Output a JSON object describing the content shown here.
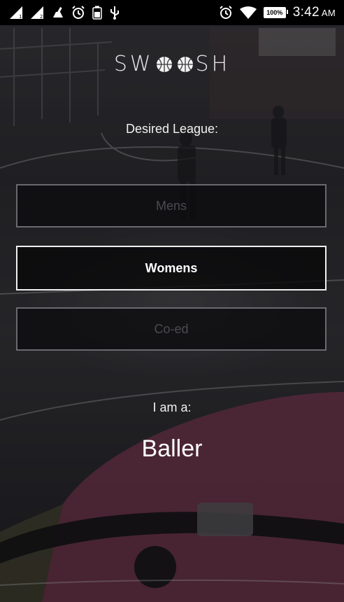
{
  "status_bar": {
    "time": "3:42",
    "ampm": "AM",
    "battery": "100%",
    "icons": [
      "signal-1-icon",
      "signal-2-icon",
      "cleaner-icon",
      "alarm-icon",
      "battery-saver-icon",
      "usb-icon",
      "alarm-icon",
      "wifi-icon"
    ]
  },
  "logo": {
    "left": "SW",
    "right": "SH"
  },
  "league": {
    "label": "Desired League:",
    "options": [
      {
        "label": "Mens",
        "selected": false
      },
      {
        "label": "Womens",
        "selected": true
      },
      {
        "label": "Co-ed",
        "selected": false
      }
    ]
  },
  "role": {
    "label": "I am a:",
    "value": "Baller"
  },
  "colors": {
    "court_paint": "#8a3a55",
    "selected_border": "#f0f0f0",
    "unselected_text": "#4b4b50"
  }
}
